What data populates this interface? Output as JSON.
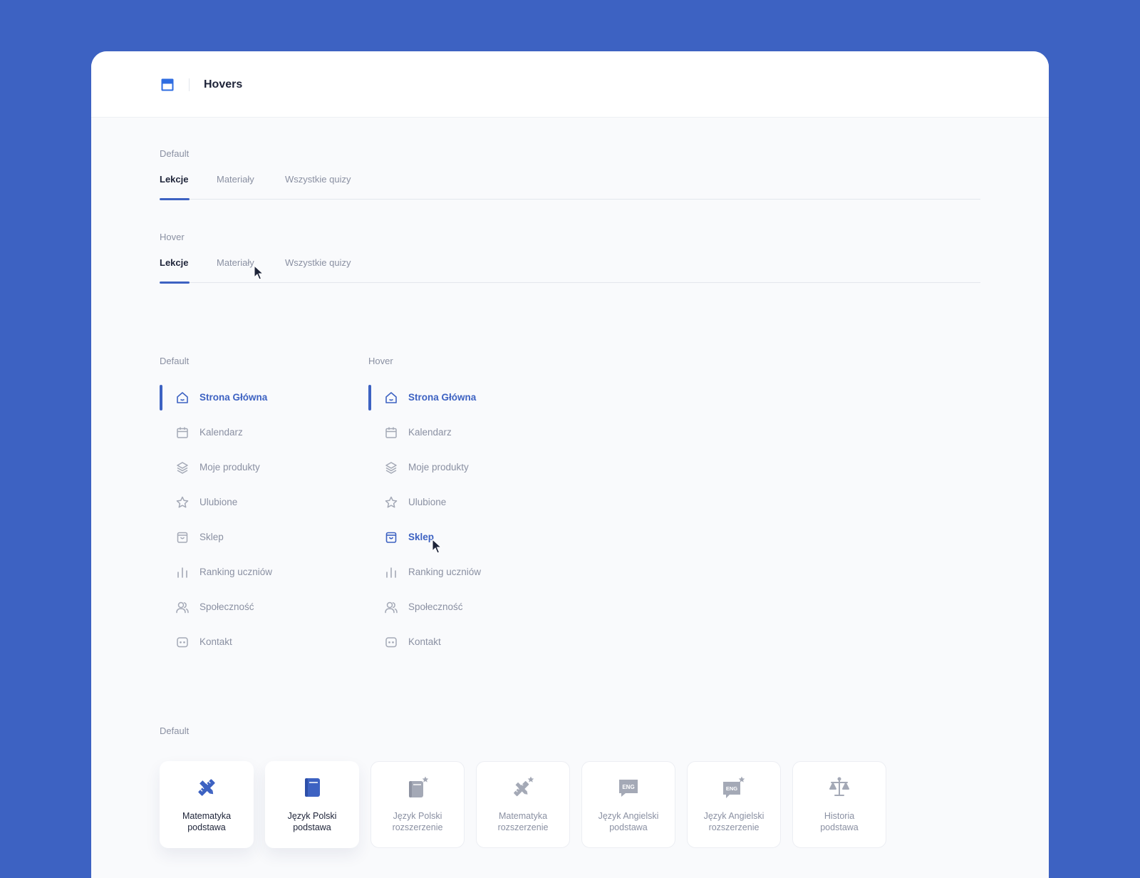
{
  "header": {
    "title": "Hovers",
    "icon": "window-icon"
  },
  "tabs_default": {
    "label": "Default",
    "tabs": [
      "Lekcje",
      "Materiały",
      "Wszystkie quizy"
    ],
    "active": "Lekcje"
  },
  "tabs_hover": {
    "label": "Hover",
    "tabs": [
      "Lekcje",
      "Materiały",
      "Wszystkie quizy"
    ],
    "active": "Lekcje",
    "hovered": "Materiały"
  },
  "nav_default": {
    "label": "Default",
    "items": [
      {
        "label": "Strona Główna",
        "icon": "home-icon"
      },
      {
        "label": "Kalendarz",
        "icon": "calendar-icon"
      },
      {
        "label": "Moje produkty",
        "icon": "layers-icon"
      },
      {
        "label": "Ulubione",
        "icon": "star-icon"
      },
      {
        "label": "Sklep",
        "icon": "shopping-bag-icon"
      },
      {
        "label": "Ranking uczniów",
        "icon": "bar-chart-icon"
      },
      {
        "label": "Społeczność",
        "icon": "users-icon"
      },
      {
        "label": "Kontakt",
        "icon": "chat-icon"
      }
    ],
    "active": "Strona Główna"
  },
  "nav_hover": {
    "label": "Hover",
    "items": [
      {
        "label": "Strona Główna",
        "icon": "home-icon"
      },
      {
        "label": "Kalendarz",
        "icon": "calendar-icon"
      },
      {
        "label": "Moje produkty",
        "icon": "layers-icon"
      },
      {
        "label": "Ulubione",
        "icon": "star-icon"
      },
      {
        "label": "Sklep",
        "icon": "shopping-bag-icon"
      },
      {
        "label": "Ranking uczniów",
        "icon": "bar-chart-icon"
      },
      {
        "label": "Społeczność",
        "icon": "users-icon"
      },
      {
        "label": "Kontakt",
        "icon": "chat-icon"
      }
    ],
    "active": "Strona Główna",
    "hovered": "Sklep"
  },
  "subjects": {
    "label": "Default",
    "cards": [
      {
        "line1": "Matematyka",
        "line2": "podstawa",
        "icon": "ruler-pencil-icon"
      },
      {
        "line1": "Język Polski",
        "line2": "podstawa",
        "icon": "book-icon"
      },
      {
        "line1": "Język Polski",
        "line2": "rozszerzenie",
        "icon": "book-star-icon"
      },
      {
        "line1": "Matematyka",
        "line2": "rozszerzenie",
        "icon": "ruler-pencil-star-icon"
      },
      {
        "line1": "Język Angielski",
        "line2": "podstawa",
        "icon": "eng-bubble-icon"
      },
      {
        "line1": "Język Angielski",
        "line2": "rozszerzenie",
        "icon": "eng-bubble-star-icon"
      },
      {
        "line1": "Historia",
        "line2": "podstawa",
        "icon": "scales-icon"
      }
    ],
    "eng_badge": "ENG"
  },
  "colors": {
    "background": "#3d62c2",
    "accent": "#3d62c2",
    "text_dark": "#1d2338",
    "text_muted": "#8a90a2",
    "icon_muted": "#a4a9b6",
    "card_bg": "#f9fafc"
  }
}
